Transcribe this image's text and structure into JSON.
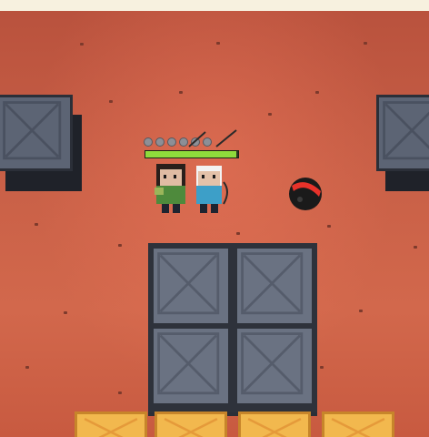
{
  "game": {
    "hud": {
      "ammo_total": 6,
      "ammo_filled": 6,
      "health_fraction": 0.98,
      "health_color": "#8fdc3c"
    },
    "entities": {
      "player_1": {
        "icon": "green-hooded-archer-icon"
      },
      "player_2": {
        "icon": "blue-shirt-archer-icon"
      },
      "enemy": {
        "icon": "black-bomb-icon",
        "accent": "#e8322a"
      }
    },
    "colors": {
      "floor": "#c85a40",
      "crate": "#6a7282",
      "crate_outline": "#2e323b",
      "goal_crate": "#f2b84e"
    }
  }
}
